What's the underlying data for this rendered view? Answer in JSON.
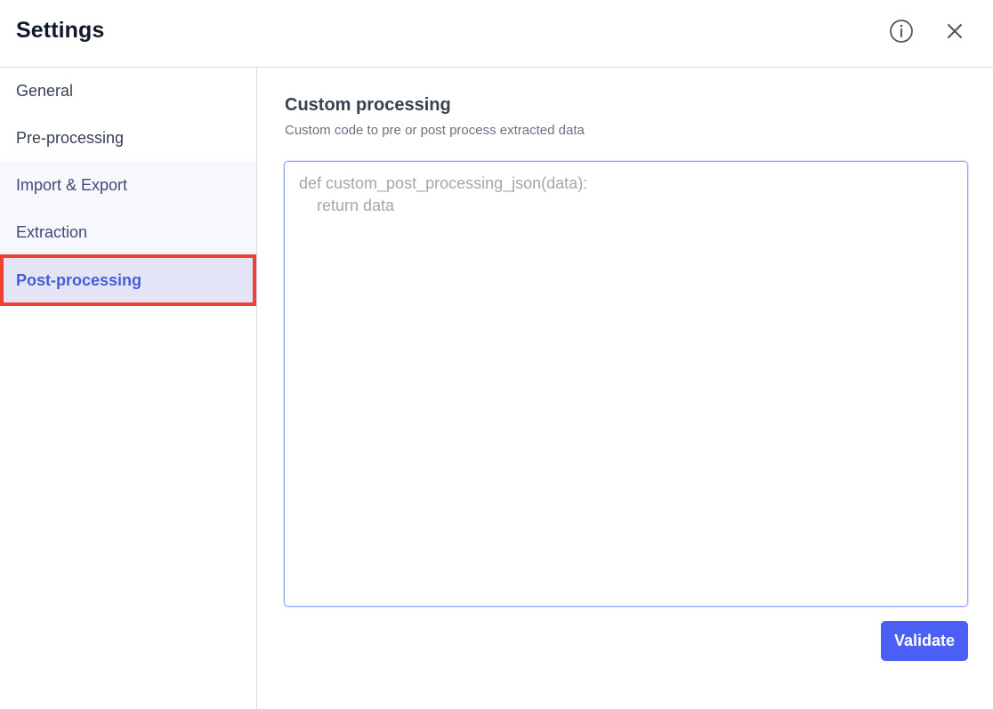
{
  "header": {
    "title": "Settings",
    "info_icon": "info-icon",
    "close_icon": "close-icon"
  },
  "sidebar": {
    "items": [
      {
        "label": "General"
      },
      {
        "label": "Pre-processing"
      },
      {
        "label": "Import & Export"
      },
      {
        "label": "Extraction"
      },
      {
        "label": "Post-processing",
        "active": true
      }
    ]
  },
  "main": {
    "section_title": "Custom processing",
    "section_subtitle": "Custom code to pre or post process extracted data",
    "code_placeholder": "def custom_post_processing_json(data):\n    return data",
    "validate_label": "Validate"
  },
  "colors": {
    "accent": "#4c5ff5",
    "active_text": "#4a5bd8",
    "active_bg": "#e3e5f6",
    "highlight_border": "#f23f33"
  }
}
